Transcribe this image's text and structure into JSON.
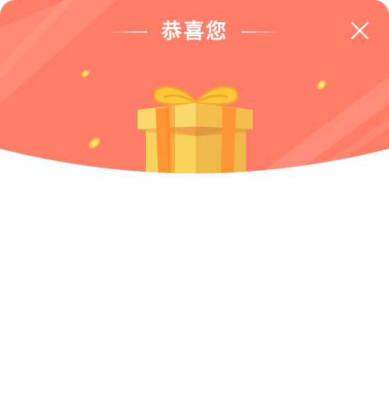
{
  "dialog": {
    "title": "恭喜您",
    "close_icon": "close-icon",
    "illustration_icon": "gift-box-icon"
  },
  "colors": {
    "header": "#FF7C66",
    "gift_yellow": "#F8D45C",
    "ribbon_orange": "#FF9533",
    "background": "#FFFFFF"
  }
}
